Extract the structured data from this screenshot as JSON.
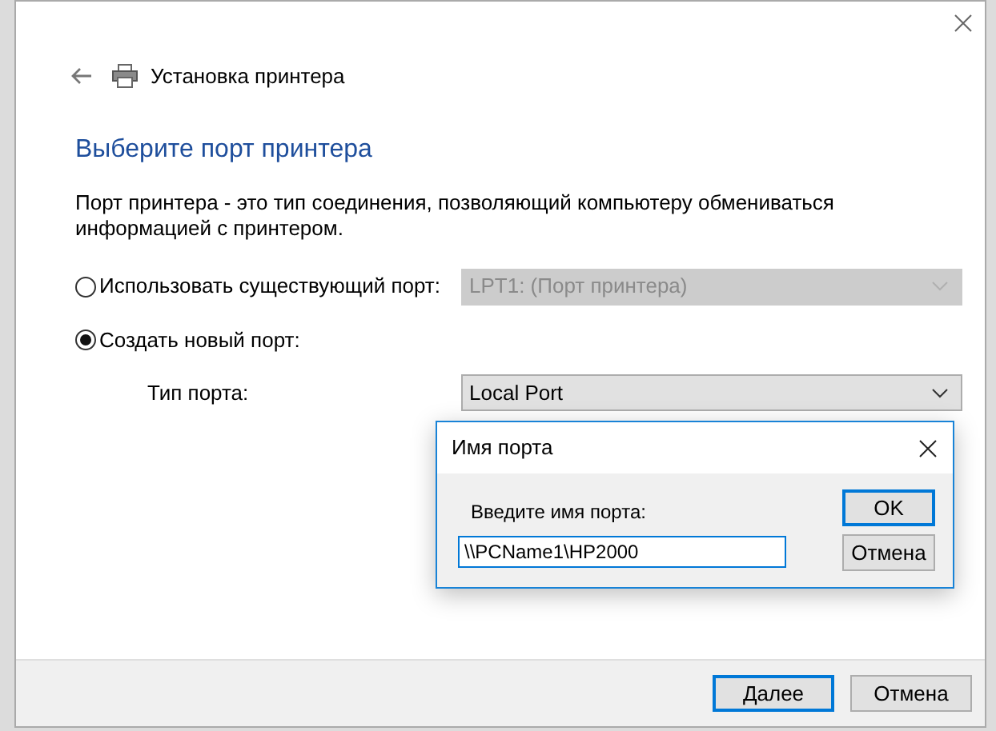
{
  "wizard": {
    "title": "Установка принтера",
    "heading": "Выберите порт принтера",
    "description": "Порт принтера - это тип соединения, позволяющий компьютеру обмениваться информацией с принтером."
  },
  "port_options": [
    {
      "kind": "existing",
      "label": "Использовать существующий порт:",
      "selected": false,
      "dropdown": {
        "value": "LPT1: (Порт принтера)",
        "disabled": true
      }
    },
    {
      "kind": "new",
      "label": "Создать новый порт:",
      "selected": true,
      "sub_label": "Тип порта:",
      "dropdown": {
        "value": "Local Port",
        "disabled": false
      }
    }
  ],
  "port_name_dialog": {
    "title": "Имя порта",
    "prompt": "Введите имя порта:",
    "value": "\\\\PCName1\\HP2000",
    "buttons": [
      {
        "label": "OK",
        "default": true
      },
      {
        "label": "Отмена",
        "default": false
      }
    ]
  },
  "footer_buttons": [
    {
      "label": "Далее",
      "default": true
    },
    {
      "label": "Отмена",
      "default": false
    }
  ]
}
